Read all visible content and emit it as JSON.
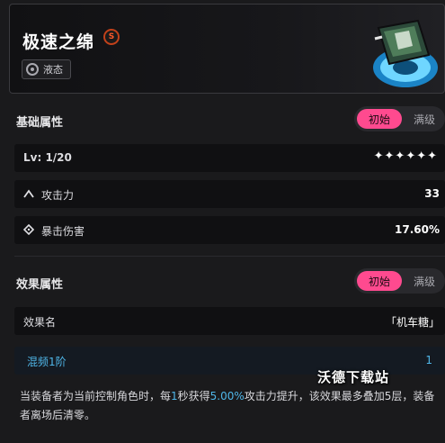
{
  "item": {
    "name": "极速之绵",
    "rank_glyph": "S",
    "type_label": "液态"
  },
  "base_section": {
    "title": "基础属性",
    "toggle_active": "初始",
    "toggle_inactive": "满级",
    "level": "Lv: 1/20",
    "stars": "✦✦✦✦✦✦",
    "stats": [
      {
        "label": "攻击力",
        "value": "33",
        "icon": "attack-arrow-icon"
      },
      {
        "label": "暴击伤害",
        "value": "17.60%",
        "icon": "crit-diamond-icon"
      }
    ]
  },
  "effect_section": {
    "title": "效果属性",
    "toggle_active": "初始",
    "toggle_inactive": "满级",
    "name_label": "效果名",
    "name_value": "「机车糖」",
    "tier_label": "混频1阶",
    "tier_value": "1",
    "desc_part1": "当装备者为当前控制角色时，每",
    "desc_hl1": "1",
    "desc_part2": "秒获得",
    "desc_hl2": "5.00%",
    "desc_part3": "攻击力提升，该效果最多叠加5层，装备者离场后清零。"
  },
  "watermark": "沃德下载站",
  "colors": {
    "accent_pink": "#ff4a8f",
    "highlight_blue": "#4fb6e8",
    "rank_orange": "#ff5a2a"
  }
}
